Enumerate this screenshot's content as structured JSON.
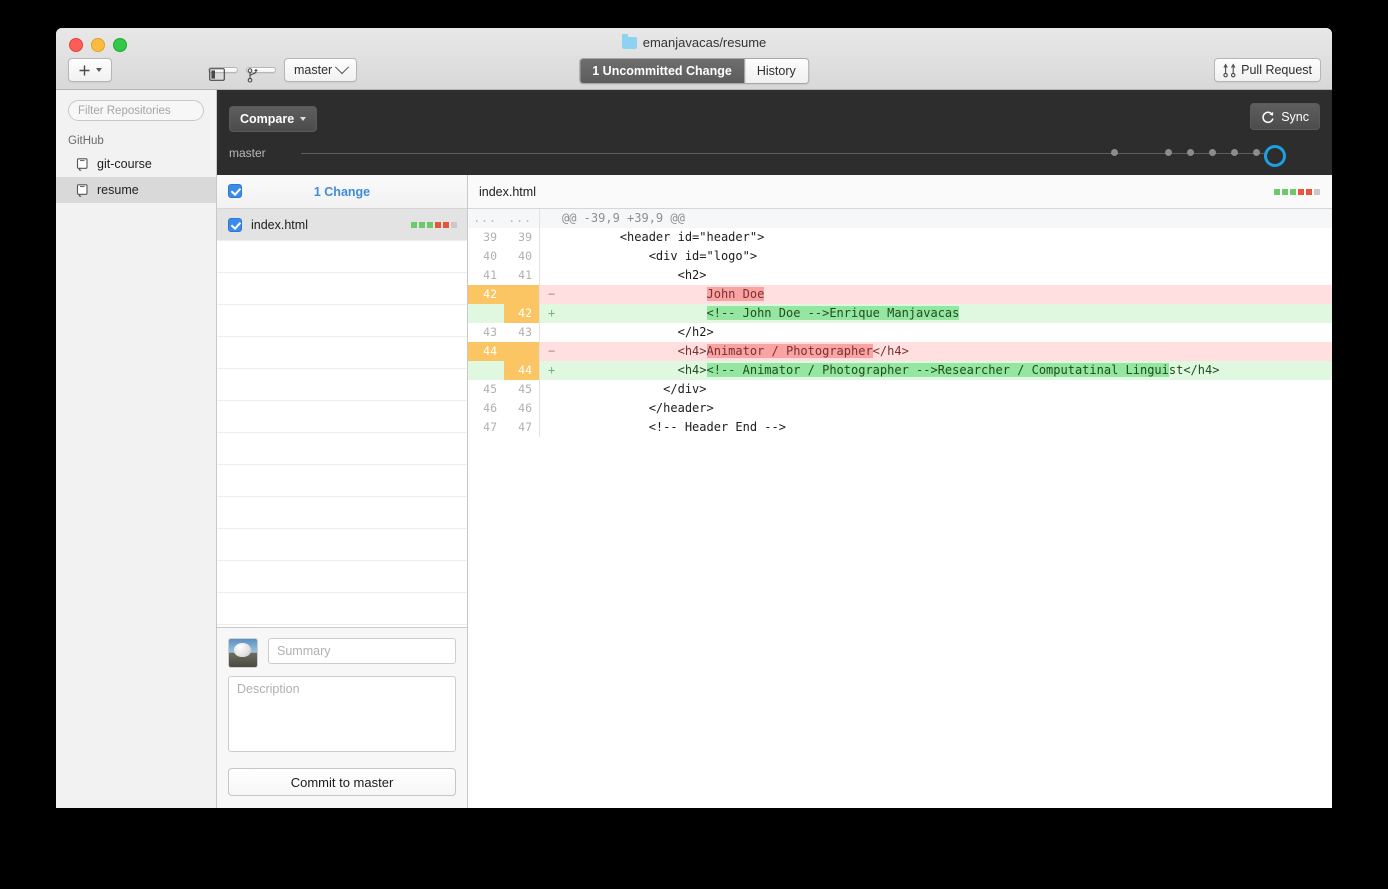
{
  "window": {
    "title": "emanjavacas/resume",
    "folder_icon": "folder-icon"
  },
  "titlebar": {
    "add_repo_label": "+",
    "sidebar_toggle_icon": "sidebar-toggle-icon",
    "new_branch_icon": "new-branch-icon",
    "branch_label": "master",
    "pull_request_label": "Pull Request",
    "pull_request_icon": "pull-request-icon",
    "tabs": [
      {
        "label": "1 Uncommitted Change",
        "active": true
      },
      {
        "label": "History",
        "active": false
      }
    ]
  },
  "sidebar": {
    "filter_placeholder": "Filter Repositories",
    "section_label": "GitHub",
    "items": [
      {
        "label": "git-course",
        "selected": false
      },
      {
        "label": "resume",
        "selected": true
      }
    ]
  },
  "compare_bar": {
    "compare_label": "Compare",
    "sync_label": "Sync",
    "sync_icon": "sync-icon",
    "branch_label": "master",
    "commit_dots": 6,
    "head_dot_color": "#1e9fe0"
  },
  "changes": {
    "header_label": "1 Change",
    "header_checked": true,
    "files": [
      {
        "name": "index.html",
        "checked": true,
        "selected": true,
        "stats": [
          "#6cc96c",
          "#6cc96c",
          "#6cc96c",
          "#e4573c",
          "#e4573c",
          "#c9c9c9"
        ]
      }
    ],
    "empty_rows": 12
  },
  "commit_form": {
    "summary_placeholder": "Summary",
    "summary_value": "",
    "description_placeholder": "Description",
    "description_value": "",
    "commit_button_label": "Commit to master",
    "avatar_name": "user-avatar"
  },
  "diff": {
    "filename": "index.html",
    "stats": [
      "#6cc96c",
      "#6cc96c",
      "#6cc96c",
      "#e4573c",
      "#e4573c",
      "#c9c9c9"
    ],
    "lines": [
      {
        "type": "hunk",
        "old": "...",
        "new": "...",
        "sign": "",
        "code": "@@ -39,9 +39,9 @@"
      },
      {
        "type": "ctx",
        "old": "39",
        "new": "39",
        "sign": "",
        "code": "        <header id=\"header\">"
      },
      {
        "type": "ctx",
        "old": "40",
        "new": "40",
        "sign": "",
        "code": "            <div id=\"logo\">"
      },
      {
        "type": "ctx",
        "old": "41",
        "new": "41",
        "sign": "",
        "code": "                <h2>"
      },
      {
        "type": "del",
        "old": "42",
        "new": "",
        "sign": "−",
        "code": "                    John Doe",
        "hl_start": 20,
        "hl_end": 28
      },
      {
        "type": "add",
        "old": "",
        "new": "42",
        "sign": "+",
        "code": "                    <!-- John Doe -->Enrique Manjavacas",
        "hl_start": 20,
        "hl_end": 57
      },
      {
        "type": "ctx",
        "old": "43",
        "new": "43",
        "sign": "",
        "code": "                </h2>"
      },
      {
        "type": "del",
        "old": "44",
        "new": "",
        "sign": "−",
        "code": "                <h4>Animator / Photographer</h4>",
        "hl_start": 20,
        "hl_end": 43
      },
      {
        "type": "add",
        "old": "",
        "new": "44",
        "sign": "+",
        "code": "                <h4><!-- Animator / Photographer -->Researcher / Computatinal Linguist</h4>",
        "hl_start": 20,
        "hl_end": 84
      },
      {
        "type": "ctx",
        "old": "45",
        "new": "45",
        "sign": "",
        "code": "              </div>"
      },
      {
        "type": "ctx",
        "old": "46",
        "new": "46",
        "sign": "",
        "code": "            </header>"
      },
      {
        "type": "ctx",
        "old": "47",
        "new": "47",
        "sign": "",
        "code": "            <!-- Header End -->"
      }
    ]
  }
}
